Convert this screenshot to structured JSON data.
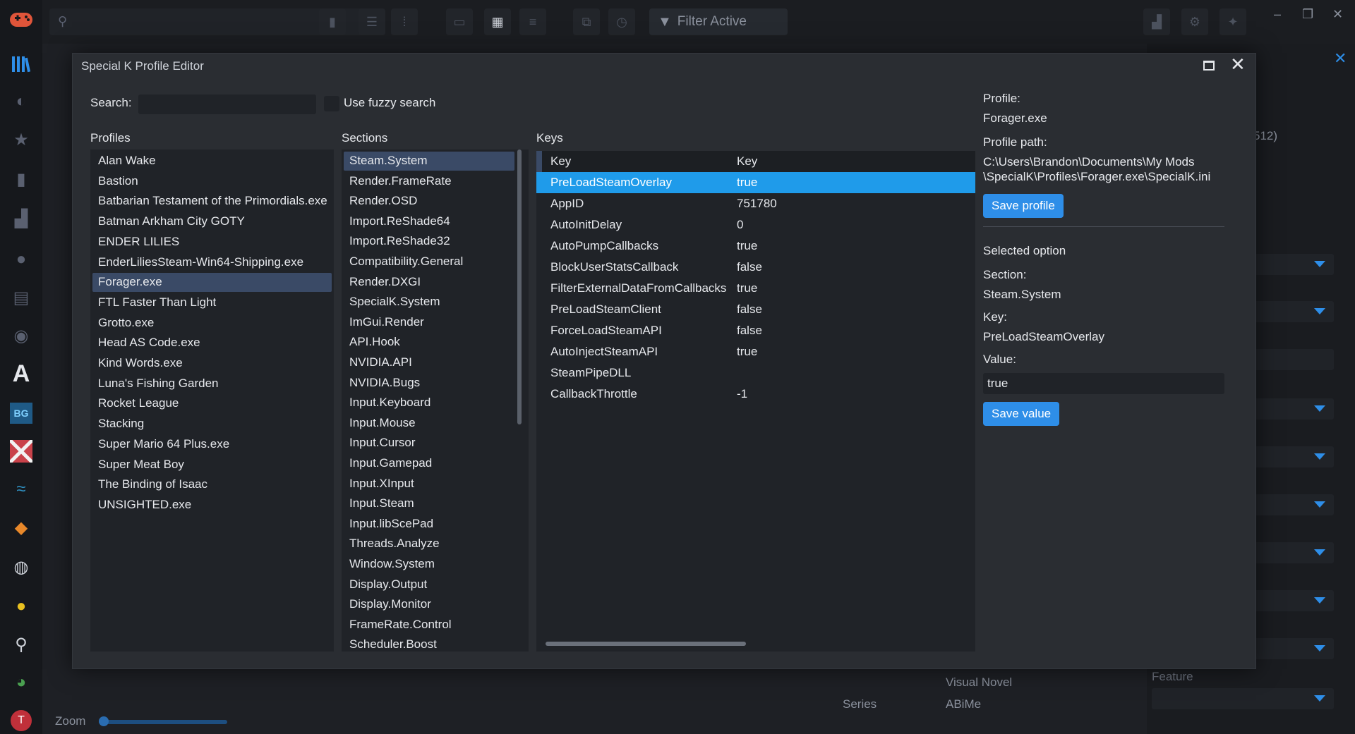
{
  "topbar": {
    "filter_label": "Filter Active"
  },
  "background": {
    "zoom_label": "Zoom",
    "genre_value": "Visual Novel",
    "series_label": "Series",
    "series_value": "ABiMe",
    "feature_label": "Feature",
    "partial_text": "512)"
  },
  "dialog": {
    "title": "Special K Profile Editor",
    "search_label": "Search:",
    "search_value": "",
    "fuzzy_label": "Use fuzzy search",
    "profiles_header": "Profiles",
    "sections_header": "Sections",
    "keys_header": "Keys",
    "profiles": [
      "Alan Wake",
      "Bastion",
      "Batbarian Testament of the Primordials.exe",
      "Batman Arkham City GOTY",
      "ENDER LILIES",
      "EnderLiliesSteam-Win64-Shipping.exe",
      "Forager.exe",
      "FTL Faster Than Light",
      "Grotto.exe",
      "Head AS Code.exe",
      "Kind Words.exe",
      "Luna's Fishing Garden",
      "Rocket League",
      "Stacking",
      "Super Mario 64 Plus.exe",
      "Super Meat Boy",
      "The Binding of Isaac",
      "UNSIGHTED.exe"
    ],
    "selected_profile_index": 6,
    "sections": [
      "Steam.System",
      "Render.FrameRate",
      "Render.OSD",
      "Import.ReShade64",
      "Import.ReShade32",
      "Compatibility.General",
      "Render.DXGI",
      "SpecialK.System",
      "ImGui.Render",
      "API.Hook",
      "NVIDIA.API",
      "NVIDIA.Bugs",
      "Input.Keyboard",
      "Input.Mouse",
      "Input.Cursor",
      "Input.Gamepad",
      "Input.XInput",
      "Input.Steam",
      "Input.libScePad",
      "Threads.Analyze",
      "Window.System",
      "Display.Output",
      "Display.Monitor",
      "FrameRate.Control",
      "Scheduler.Boost"
    ],
    "selected_section_index": 0,
    "keys_columns": [
      "Key",
      "Key"
    ],
    "keys": [
      [
        "PreLoadSteamOverlay",
        "true"
      ],
      [
        "AppID",
        "751780"
      ],
      [
        "AutoInitDelay",
        "0"
      ],
      [
        "AutoPumpCallbacks",
        "true"
      ],
      [
        "BlockUserStatsCallback",
        "false"
      ],
      [
        "FilterExternalDataFromCallbacks",
        "true"
      ],
      [
        "PreLoadSteamClient",
        "false"
      ],
      [
        "ForceLoadSteamAPI",
        "false"
      ],
      [
        "AutoInjectSteamAPI",
        "true"
      ],
      [
        "SteamPipeDLL",
        ""
      ],
      [
        "CallbackThrottle",
        "-1"
      ]
    ],
    "selected_key_index": 0,
    "right": {
      "profile_label": "Profile:",
      "profile_value": "Forager.exe",
      "path_label": "Profile path:",
      "path_line1": "C:\\Users\\Brandon\\Documents\\My Mods",
      "path_line2": "\\SpecialK\\Profiles\\Forager.exe\\SpecialK.ini",
      "save_profile": "Save profile",
      "selected_option": "Selected option",
      "section_label": "Section:",
      "section_value": "Steam.System",
      "key_label": "Key:",
      "key_value": "PreLoadSteamOverlay",
      "value_label": "Value:",
      "value_value": "true",
      "save_value": "Save value"
    }
  },
  "colors": {
    "accent": "#2e8ee8",
    "selected_row": "#1f9bea",
    "selected_list": "#3a4a66"
  }
}
